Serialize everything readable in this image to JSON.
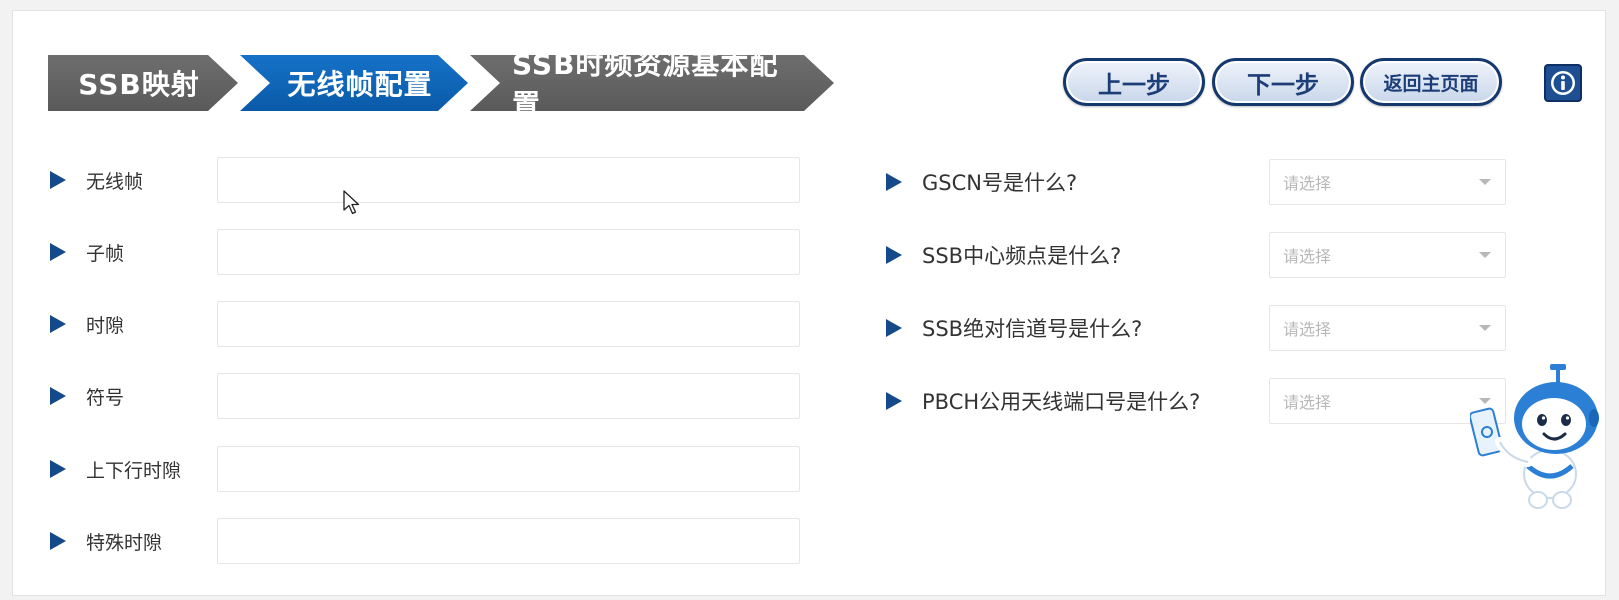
{
  "steps": [
    {
      "label": "SSB映射",
      "state": "done"
    },
    {
      "label": "无线帧配置",
      "state": "active"
    },
    {
      "label": "SSB时频资源基本配置",
      "state": "pending"
    }
  ],
  "nav": {
    "prev_label": "上一步",
    "next_label": "下一步",
    "home_label": "返回主页面",
    "info_icon": "info-icon"
  },
  "form": {
    "fields": [
      {
        "label": "无线帧",
        "value": ""
      },
      {
        "label": "子帧",
        "value": ""
      },
      {
        "label": "时隙",
        "value": ""
      },
      {
        "label": "符号",
        "value": ""
      },
      {
        "label": "上下行时隙",
        "value": ""
      },
      {
        "label": "特殊时隙",
        "value": ""
      }
    ]
  },
  "questions": [
    {
      "label": "GSCN号是什么?",
      "placeholder": "请选择"
    },
    {
      "label": "SSB中心频点是什么?",
      "placeholder": "请选择"
    },
    {
      "label": "SSB绝对信道号是什么?",
      "placeholder": "请选择"
    },
    {
      "label": "PBCH公用天线端口号是什么?",
      "placeholder": "请选择"
    }
  ],
  "colors": {
    "active_step": "#0a5aa8",
    "inactive_step": "#5a5a5a",
    "button_border": "#15386e",
    "row_marker": "#154a8a"
  },
  "icons": [
    "info-icon",
    "triangle-marker-icon",
    "chevron-down-icon",
    "mouse-cursor-icon",
    "robot-mascot-icon"
  ]
}
